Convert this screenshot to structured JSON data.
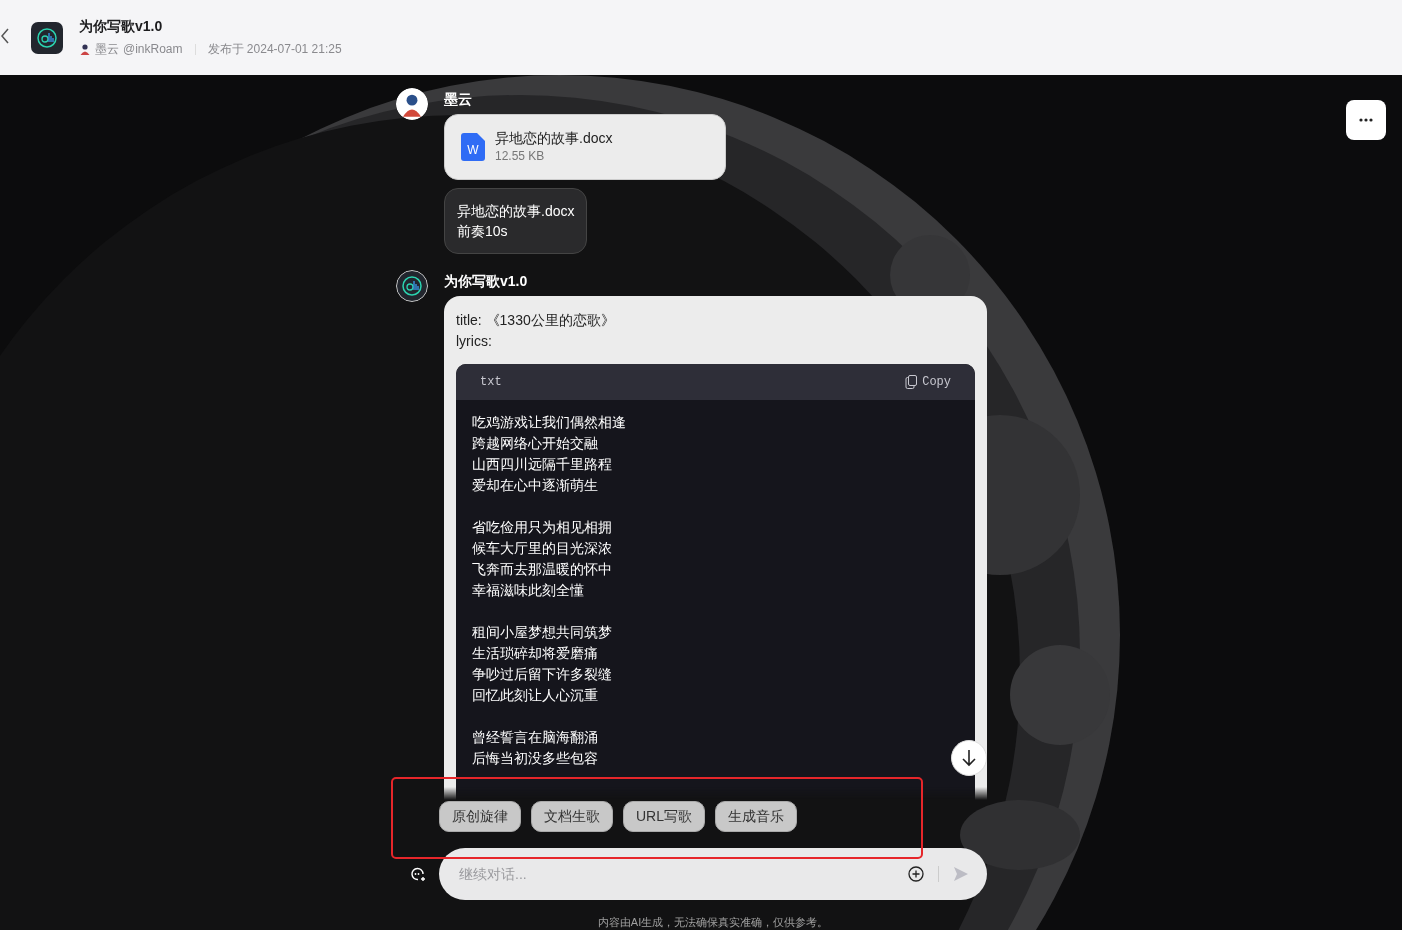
{
  "header": {
    "title": "为你写歌v1.0",
    "author": "墨云",
    "handle": "@inkRoam",
    "published": "发布于 2024-07-01 21:25"
  },
  "messages": [
    {
      "kind": "user",
      "sender": "墨云",
      "file": {
        "name": "异地恋的故事.docx",
        "size": "12.55 KB",
        "type_letter": "W"
      },
      "text_lines": [
        "异地恋的故事.docx",
        "前奏10s"
      ]
    },
    {
      "kind": "bot",
      "sender": "为你写歌v1.0",
      "lines": [
        "title: 《1330公里的恋歌》",
        "lyrics:"
      ],
      "code": {
        "language": "txt",
        "copy_label": "Copy",
        "stanzas": [
          [
            "吃鸡游戏让我们偶然相逢",
            "跨越网络心开始交融",
            "山西四川远隔千里路程",
            "爱却在心中逐渐萌生"
          ],
          [
            "省吃俭用只为相见相拥",
            "候车大厅里的目光深浓",
            "飞奔而去那温暖的怀中",
            "幸福滋味此刻全懂"
          ],
          [
            "租间小屋梦想共同筑梦",
            "生活琐碎却将爱磨痛",
            "争吵过后留下许多裂缝",
            "回忆此刻让人心沉重"
          ],
          [
            "曾经誓言在脑海翻涌",
            "后悔当初没多些包容"
          ]
        ]
      }
    }
  ],
  "suggestions": [
    "原创旋律",
    "文档生歌",
    "URL写歌",
    "生成音乐"
  ],
  "annotation_box": {
    "shown": true
  },
  "input": {
    "placeholder": "继续对话..."
  },
  "disclaimer": "内容由AI生成，无法确保真实准确，仅供参考。"
}
